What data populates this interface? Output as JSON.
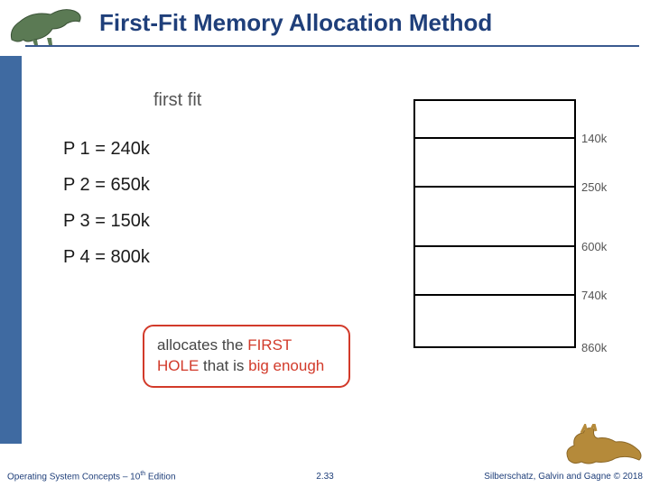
{
  "header": {
    "title": "First-Fit Memory Allocation Method"
  },
  "content": {
    "algorithm_label": "first fit",
    "processes": [
      {
        "label": "P 1 = 240k"
      },
      {
        "label": "P 2 = 650k"
      },
      {
        "label": "P 3 = 150k"
      },
      {
        "label": "P 4 = 800k"
      }
    ],
    "memory_blocks": [
      {
        "size_label": "140k"
      },
      {
        "size_label": "250k"
      },
      {
        "size_label": "600k"
      },
      {
        "size_label": "740k"
      },
      {
        "size_label": "860k"
      }
    ],
    "callout": {
      "pre": "allocates the ",
      "em1": "FIRST HOLE",
      "mid": " that is ",
      "em2": "big enough"
    }
  },
  "footer": {
    "left_pre": "Operating System Concepts – 10",
    "left_sup": "th",
    "left_post": " Edition",
    "center": "2.33",
    "right": "Silberschatz, Galvin and Gagne © 2018"
  },
  "icons": {
    "dino_top_color": "#5b7a54",
    "dino_bottom_color": "#b58a3a"
  }
}
